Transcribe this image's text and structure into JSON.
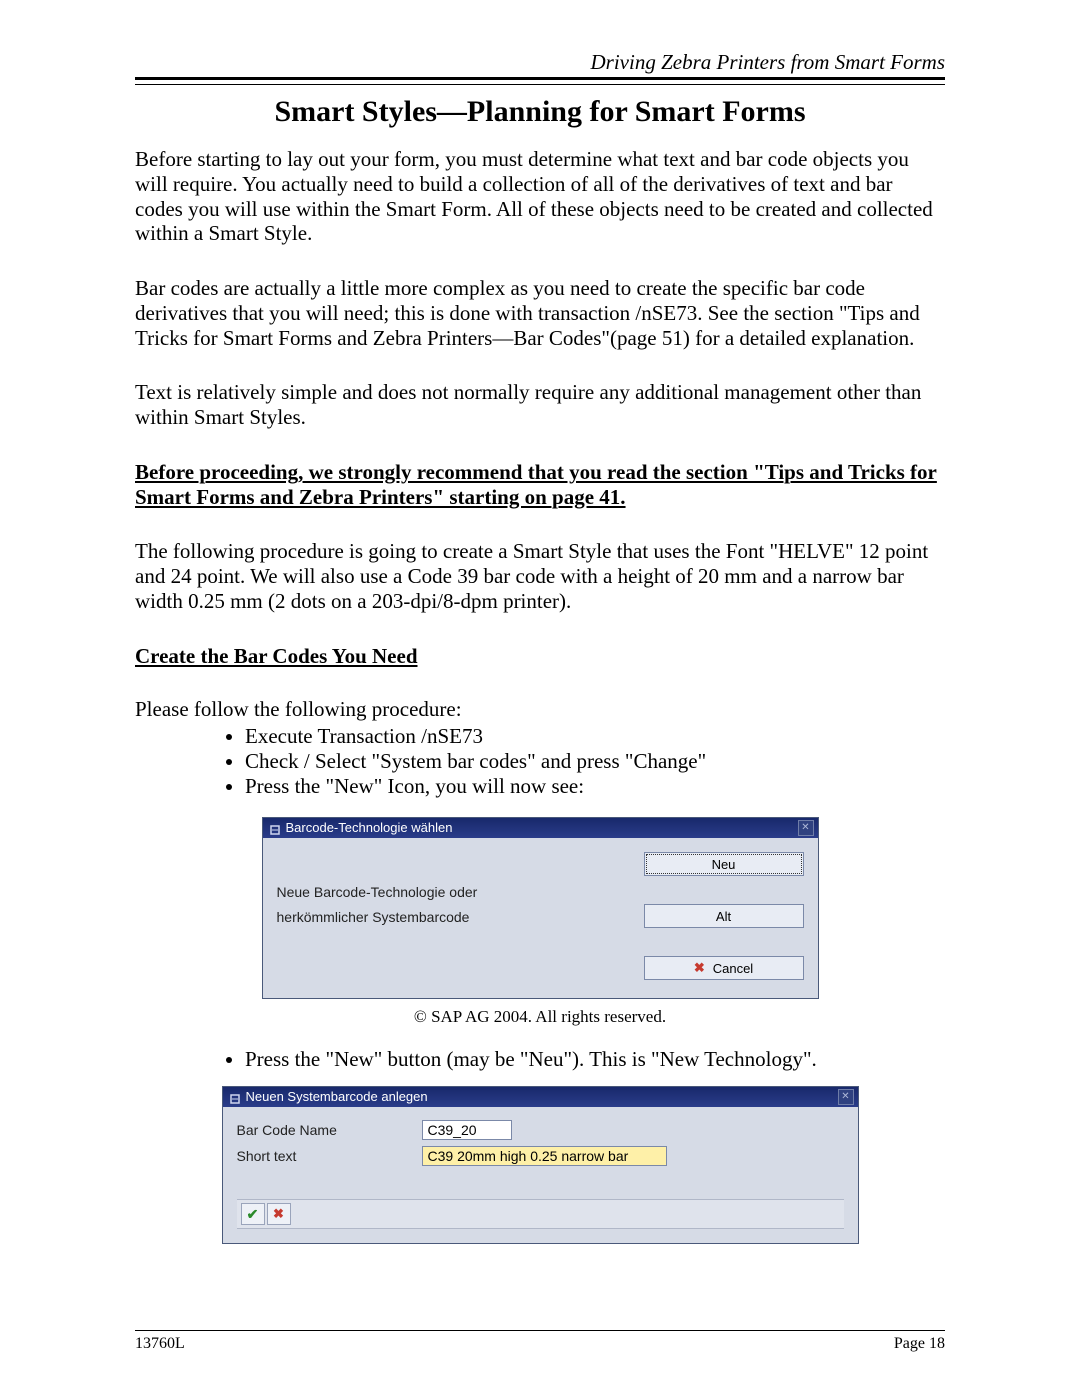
{
  "header": {
    "running": "Driving Zebra Printers from Smart Forms"
  },
  "title": "Smart Styles—Planning for Smart Forms",
  "para1": "Before starting to lay out your form, you must determine what text and bar code objects you will require. You actually need to build a collection of all of the derivatives of text and bar codes you will use within the Smart Form. All of these objects need to be created and collected within a Smart Style.",
  "para2": "Bar codes are actually a little more complex as you need to create the specific bar code derivatives that you will need; this is done with transaction /nSE73. See the section \"Tips and Tricks for Smart Forms and Zebra Printers—Bar Codes\"(page 51) for a detailed explanation.",
  "para3": "Text is relatively simple and does not normally require any additional management other than within Smart Styles.",
  "para4": "Before proceeding, we strongly recommend that you read the section \"Tips and Tricks for Smart Forms and Zebra Printers\" starting on page 41.",
  "para5": "The following procedure is going to create a Smart Style that uses the Font \"HELVE\" 12 point and 24 point. We will also use a Code 39 bar code with a height of 20 mm and a narrow bar width 0.25 mm (2 dots on a 203-dpi/8-dpm printer).",
  "subhead": "Create the Bar Codes You Need",
  "intro_line": "Please follow the following procedure:",
  "bullets1": [
    "Execute Transaction /nSE73",
    "Check / Select \"System bar codes\" and press \"Change\"",
    "Press the \"New\" Icon, you will now see:"
  ],
  "dialog1": {
    "title": "Barcode-Technologie wählen",
    "line1": "Neue Barcode-Technologie oder",
    "line2": "herkömmlicher Systembarcode",
    "neu": "Neu",
    "alt": "Alt",
    "cancel": "Cancel"
  },
  "caption1": "© SAP AG 2004. All rights reserved.",
  "bullets2": [
    "Press the \"New\" button (may be \"Neu\"). This is \"New Technology\"."
  ],
  "dialog2": {
    "title": "Neuen Systembarcode anlegen",
    "label_name": "Bar Code Name",
    "label_text": "Short text",
    "value_name": "C39_20",
    "value_text": "C39 20mm high 0.25 narrow bar"
  },
  "footer": {
    "doc": "13760L",
    "page": "Page 18"
  }
}
